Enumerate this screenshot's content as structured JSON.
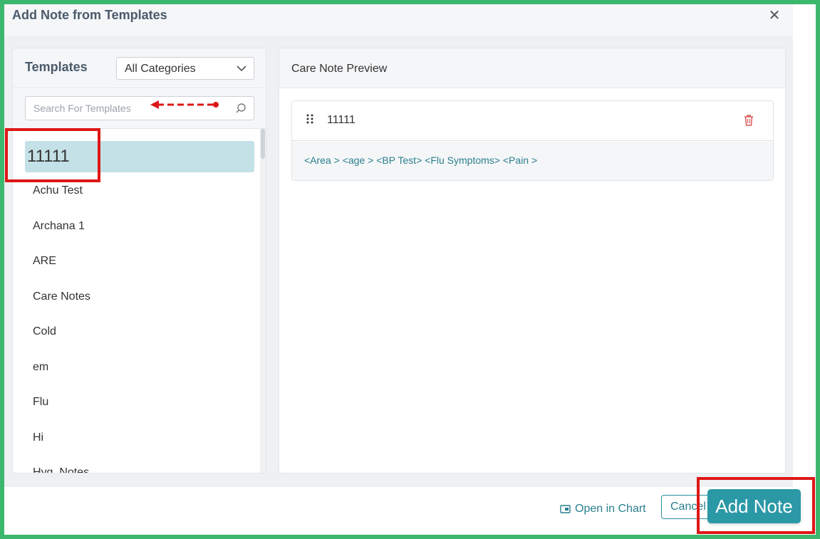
{
  "dialog": {
    "title": "Add Note from Templates",
    "close_glyph": "✕"
  },
  "templates_panel": {
    "title": "Templates",
    "category_select": {
      "selected": "All Categories"
    },
    "search": {
      "placeholder": "Search For Templates",
      "value": ""
    },
    "items": [
      {
        "label": "11111",
        "selected": true
      },
      {
        "label": "Achu Test"
      },
      {
        "label": "Archana 1"
      },
      {
        "label": "ARE"
      },
      {
        "label": "Care Notes"
      },
      {
        "label": "Cold"
      },
      {
        "label": "em"
      },
      {
        "label": "Flu"
      },
      {
        "label": "Hi"
      },
      {
        "label": "Hyg. Notes"
      }
    ]
  },
  "preview_panel": {
    "title": "Care Note Preview",
    "note": {
      "name": "11111",
      "content": "<Area > <age > <BP Test> <Flu Symptoms> <Pain >"
    }
  },
  "footer": {
    "open_in_chart": "Open in Chart",
    "cancel": "Cancel",
    "add_note": "Add Note"
  },
  "colors": {
    "accent": "#2b98a6",
    "selected_row": "#c3e1e7",
    "frame": "#3cb86e",
    "annotation": "#dd1717",
    "delete": "#d9534f"
  },
  "icons": [
    "close-icon",
    "chevron-down-icon",
    "search-icon",
    "drag-handle-icon",
    "trash-icon",
    "open-in-chart-icon"
  ]
}
